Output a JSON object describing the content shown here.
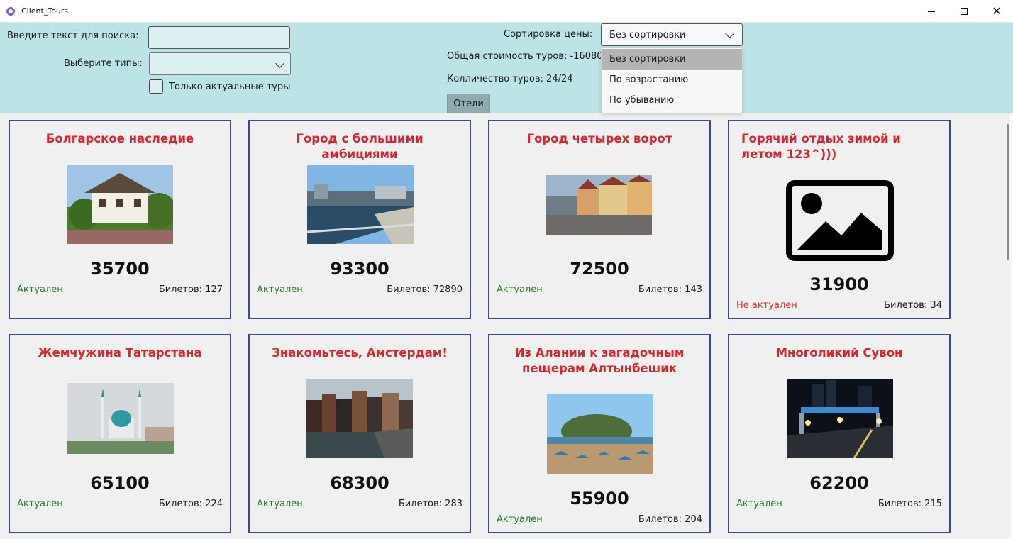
{
  "window": {
    "title": "Client_Tours",
    "minimize": "—",
    "maximize": "☐",
    "close": "✕"
  },
  "filters": {
    "search_label": "Введите текст для поиска:",
    "search_value": "",
    "types_label": "Выберите типы:",
    "actual_only_label": "Только актуальные туры",
    "actual_only_checked": false,
    "sort_label": "Сортировка цены:",
    "sort_value": "Без сортировки",
    "total_cost": "Общая стоимость туров: -16080",
    "tour_count": "Колличество туров: 24/24",
    "hotels_button": "Отели"
  },
  "sort_dropdown": {
    "options": [
      "Без сортировки",
      "По возрастанию",
      "По убыванию"
    ],
    "selected_index": 0
  },
  "tours": [
    {
      "title": "Болгарское наследие",
      "price": "35700",
      "status": "Актуален",
      "actual": true,
      "tickets": "Билетов: 127",
      "image": "photo-house"
    },
    {
      "title": "Город с большими амбициями",
      "price": "93300",
      "status": "Актуален",
      "actual": true,
      "tickets": "Билетов: 72890",
      "image": "photo-river-city"
    },
    {
      "title": "Город четырех ворот",
      "price": "72500",
      "status": "Актуален",
      "actual": true,
      "tickets": "Билетов: 143",
      "image": "photo-street"
    },
    {
      "title": "Горячий отдых зимой и летом 123^)))",
      "price": "31900",
      "status": "Не актуален",
      "actual": false,
      "tickets": "Билетов: 34",
      "image": "image-placeholder-icon"
    },
    {
      "title": "Жемчужина Татарстана",
      "price": "65100",
      "status": "Актуален",
      "actual": true,
      "tickets": "Билетов: 224",
      "image": "photo-mosque"
    },
    {
      "title": "Знакомьтесь, Амстердам!",
      "price": "68300",
      "status": "Актуален",
      "actual": true,
      "tickets": "Билетов: 283",
      "image": "photo-canal"
    },
    {
      "title": "Из Алании к загадочным пещерам Алтынбешик",
      "price": "55900",
      "status": "Актуален",
      "actual": true,
      "tickets": "Билетов: 204",
      "image": "photo-beach"
    },
    {
      "title": "Многоликий Сувон",
      "price": "62200",
      "status": "Актуален",
      "actual": true,
      "tickets": "Билетов: 215",
      "image": "photo-night-city"
    }
  ]
}
